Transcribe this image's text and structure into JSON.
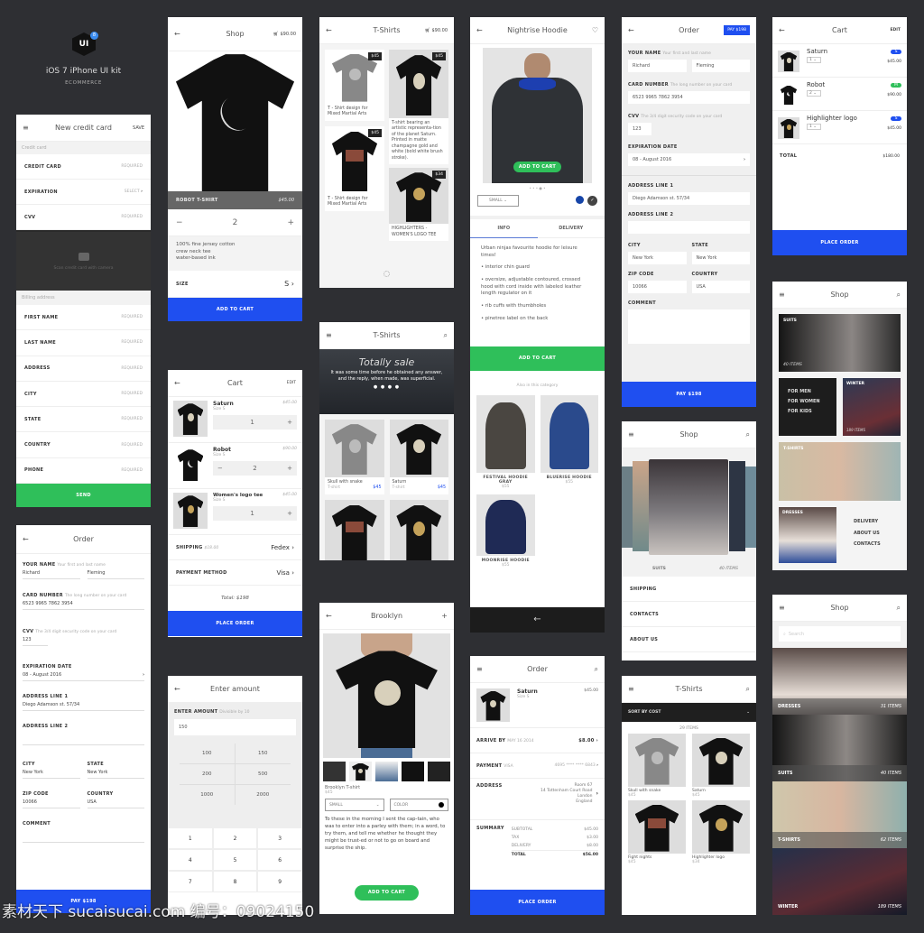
{
  "brand": {
    "logo": "UI",
    "badge": "8",
    "title": "iOS 7 iPhone UI kit",
    "subtitle": "ECOMMERCE"
  },
  "watermark": "素材天下 sucaisucai.com  编号：09024150",
  "colors": {
    "background": "#2e2f33",
    "primary": "#1f4ff0",
    "success": "#2fbf5a"
  },
  "new_card": {
    "title": "New credit card",
    "save": "SAVE",
    "section1": "Credit card",
    "rows": [
      {
        "label": "CREDIT CARD",
        "value": "REQUIRED"
      },
      {
        "label": "EXPIRATION",
        "value": "SELECT"
      },
      {
        "label": "CVV",
        "value": "REQUIRED"
      }
    ],
    "scan": "Scan credit card with camera",
    "section2": "Billing address",
    "billing": [
      {
        "label": "FIRST NAME",
        "value": "REQUIRED"
      },
      {
        "label": "LAST NAME",
        "value": "REQUIRED"
      },
      {
        "label": "ADDRESS",
        "value": "REQUIRED"
      },
      {
        "label": "CITY",
        "value": "REQUIRED"
      },
      {
        "label": "STATE",
        "value": "REQUIRED"
      },
      {
        "label": "COUNTRY",
        "value": "REQUIRED"
      },
      {
        "label": "PHONE",
        "value": "REQUIRED"
      }
    ],
    "send": "SEND"
  },
  "shop_product": {
    "title": "Shop",
    "cart": "$90.00",
    "name": "ROBOT T-SHIRT",
    "price": "$45.00",
    "qty": "2",
    "minus": "−",
    "plus": "+",
    "desc": [
      "100% fine jersey cotton",
      "crew neck tee",
      "water-based ink"
    ],
    "size_label": "SIZE",
    "size": "S",
    "add": "ADD TO CART"
  },
  "cart1": {
    "title": "Cart",
    "edit": "EDIT",
    "items": [
      {
        "name": "Saturn",
        "size": "Size S",
        "price": "$45.00",
        "qty": "1"
      },
      {
        "name": "Robot",
        "size": "Size S",
        "price": "$90.00",
        "qty": "2"
      },
      {
        "name": "Women's logo tee",
        "size": "Size S",
        "price": "$45.00",
        "qty": "1"
      }
    ],
    "shipping_label": "SHIPPING",
    "shipping_cost": "$18.00",
    "shipping": "Fedex",
    "payment_label": "PAYMENT METHOD",
    "payment": "Visa",
    "total": "Total: $198",
    "place": "PLACE ORDER"
  },
  "amount": {
    "title": "Enter amount",
    "label": "ENTER AMOUNT",
    "hint": "Divisible by 10",
    "value": "150",
    "presets": [
      "100",
      "150",
      "200",
      "500",
      "1000",
      "2000"
    ],
    "keys": [
      "1",
      "2",
      "3",
      "4",
      "5",
      "6",
      "7",
      "8",
      "9"
    ]
  },
  "order_left": {
    "title": "Order",
    "name_label": "YOUR NAME",
    "name_hint": "Your first and last name",
    "first": "Richard",
    "last": "Fleming",
    "card_label": "CARD NUMBER",
    "card_hint": "The long number on your card",
    "card": "6523 9965 7862 3954",
    "cvv_label": "CVV",
    "cvv_hint": "The 3/4 digit security code on your card",
    "cvv": "123",
    "exp_label": "EXPIRATION DATE",
    "exp": "08 - August 2016",
    "addr1_label": "ADDRESS LINE 1",
    "addr1": "Diego Adamson st. 57/34",
    "addr2_label": "ADDRESS LINE 2",
    "city_label": "CITY",
    "city": "New York",
    "state_label": "STATE",
    "state": "New York",
    "zip_label": "ZIP CODE",
    "zip": "10066",
    "country_label": "COUNTRY",
    "country": "USA",
    "comment_label": "COMMENT",
    "pay": "PAY $198"
  },
  "tshirts1": {
    "title": "T-Shirts",
    "cart": "$90.00",
    "items": [
      {
        "price": "$45",
        "text": "T - Shirt design for Mixed Martial Arts"
      },
      {
        "price": "$45",
        "text": "T-shirt bearing an artistic representa-tion of the planet Saturn. Printed in matte champagne gold and white (bold white brush stroke)."
      },
      {
        "price": "$45",
        "text": "T - Shirt design for Mixed Martial Arts"
      },
      {
        "price": "$34",
        "text": "HIGHLIGHTERS - WOMEN'S LOGO TEE"
      }
    ]
  },
  "tshirts2": {
    "title": "T-Shirts",
    "banner_title": "Totally sale",
    "banner_text": "It was some time before he obtained any answer, and the reply, when made, was superficial.",
    "items": [
      {
        "name": "Skull with snake",
        "type": "T-shirt",
        "price": "$45"
      },
      {
        "name": "Saturn",
        "type": "T-shirt",
        "price": "$45"
      }
    ]
  },
  "brooklyn": {
    "title": "Brooklyn",
    "name": "Brooklyn T-shirt",
    "price": "$45",
    "size": "SMALL",
    "color": "COLOR",
    "desc": "To these in the morning I sent the cap-tain, who was to enter into a parley with them; in a word, to try them, and tell me whether he thought they might be trust-ed or not to go on board and surprise the ship.",
    "add": "ADD TO CART"
  },
  "hoodie": {
    "title": "Nightrise Hoodie",
    "add_overlay": "ADD TO CART",
    "size": "SMALL",
    "tabs": [
      "INFO",
      "DELIVERY"
    ],
    "intro": "Urban ninjas favourite hoodie for leisure times!",
    "bullets": [
      "• interior chin guard",
      "• oversize, adjustable contoured, crossed hood with cord inside with labeled leather length regulator on it",
      "• rib cuffs with thumbholes",
      "• pinetree label on the back"
    ],
    "add": "ADD TO CART",
    "also": "Also in this category",
    "related": [
      {
        "name": "FESTIVAL HOODIE GRAY",
        "price": "$55"
      },
      {
        "name": "BLUERISE HOODIE",
        "price": "$55"
      },
      {
        "name": "MOONRISE HOODIE",
        "price": "$55"
      }
    ]
  },
  "order_summary": {
    "title": "Order",
    "item": "Saturn",
    "item_size": "Size S",
    "item_price": "$45.00",
    "arrive_label": "ARRIVE BY",
    "arrive": "MAY 16 2014",
    "arrive_cost": "$8.00",
    "payment_label": "PAYMENT",
    "payment": "VISA",
    "card": "4695 **** **** 6843",
    "address_label": "ADDRESS",
    "address": [
      "Room 67",
      "14 Tottenham Court Road",
      "London",
      "England"
    ],
    "summary_label": "SUMMARY",
    "lines": [
      {
        "k": "SUBTOTAL",
        "v": "$45.00"
      },
      {
        "k": "TAX",
        "v": "$3.00"
      },
      {
        "k": "DELIVERY",
        "v": "$8.00"
      }
    ],
    "total_label": "TOTAL",
    "total": "$56.00",
    "place": "PLACE ORDER"
  },
  "order_right": {
    "title": "Order",
    "pay_top": "PAY $198",
    "pay": "PAY $198"
  },
  "shop_carousel": {
    "title": "Shop",
    "category": "SUITS",
    "count": "40 ITEMS",
    "links": [
      "SHIPPING",
      "CONTACTS",
      "ABOUT US"
    ]
  },
  "tshirts3": {
    "title": "T-Shirts",
    "sort": "SORT BY COST",
    "count": "29 ITEMS",
    "items": [
      {
        "name": "Skull with snake",
        "price": "$45"
      },
      {
        "name": "Saturn",
        "price": "$45"
      },
      {
        "name": "Fight nights",
        "price": "$45"
      },
      {
        "name": "Highlighter logo",
        "price": "$34"
      }
    ]
  },
  "cart2": {
    "title": "Cart",
    "edit": "EDIT",
    "items": [
      {
        "name": "Saturn",
        "qty": "1",
        "size": "S",
        "price": "$45.00",
        "badge_color": "#1f4ff0"
      },
      {
        "name": "Robot",
        "qty": "2",
        "size": "M",
        "price": "$90.00",
        "badge_color": "#2fbf5a"
      },
      {
        "name": "Highlighter logo",
        "qty": "1",
        "size": "S",
        "price": "$45.00",
        "badge_color": "#1f4ff0"
      }
    ],
    "total_label": "TOTAL",
    "total": "$180.00",
    "place": "PLACE ORDER"
  },
  "shop_grid": {
    "title": "Shop",
    "suits": "SUITS",
    "suits_count": "40 ITEMS",
    "menu": [
      "FOR MEN",
      "FOR WOMEN",
      "FOR KIDS"
    ],
    "winter": "WINTER",
    "winter_count": "189 ITEMS",
    "tshirts": "T-SHIRTS",
    "dresses": "DRESSES",
    "links": [
      "DELIVERY",
      "ABOUT US",
      "CONTACTS"
    ]
  },
  "shop_list": {
    "title": "Shop",
    "search_placeholder": "Search",
    "categories": [
      {
        "name": "DRESSES",
        "count": "31 ITEMS"
      },
      {
        "name": "SUITS",
        "count": "40 ITEMS"
      },
      {
        "name": "T-SHIRTS",
        "count": "62 ITEMS"
      },
      {
        "name": "WINTER",
        "count": "189 ITEMS"
      }
    ]
  }
}
